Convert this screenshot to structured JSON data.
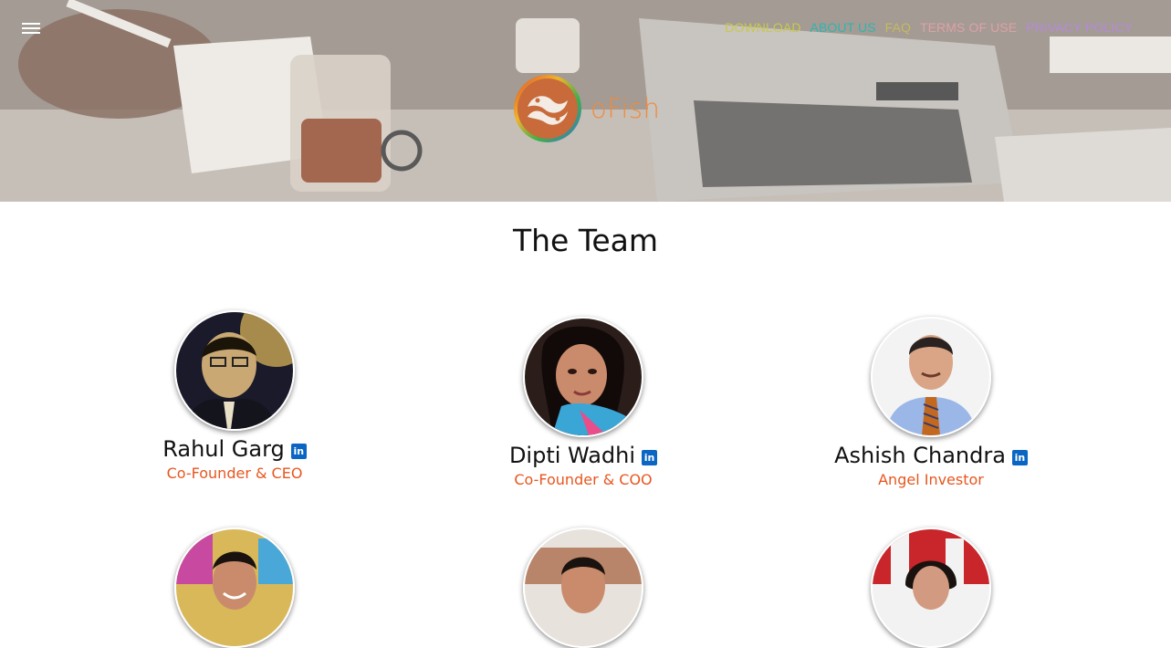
{
  "header": {
    "menu_icon": "hamburger-menu-icon",
    "nav": [
      {
        "label": "DOWNLOAD",
        "color": "#c9c94a"
      },
      {
        "label": "ABOUT US",
        "color": "#2fb5b0"
      },
      {
        "label": "FAQ",
        "color": "#c8b860"
      },
      {
        "label": "TERMS OF USE",
        "color": "#e0a0a8"
      },
      {
        "label": "PRIVACY POLICY",
        "color": "#b78ad9"
      }
    ],
    "brand": {
      "name": "oFish",
      "color": "#f08a3c"
    }
  },
  "team": {
    "title": "The Team",
    "members": [
      {
        "name": "Rahul Garg",
        "role": "Co-Founder & CEO",
        "social": "linkedin-icon"
      },
      {
        "name": "Dipti Wadhi",
        "role": "Co-Founder & COO",
        "social": "linkedin-icon"
      },
      {
        "name": "Ashish Chandra",
        "role": "Angel Investor",
        "social": "linkedin-icon"
      }
    ],
    "linkedin_glyph": "in"
  },
  "colors": {
    "role": "#e8561f",
    "linkedin": "#0a66c2"
  }
}
